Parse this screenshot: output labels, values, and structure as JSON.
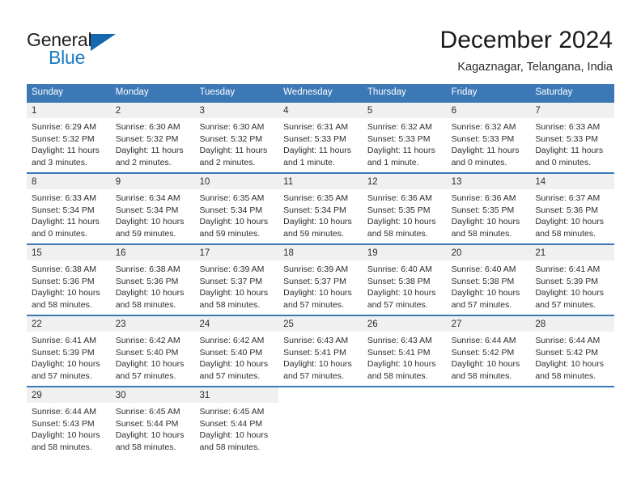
{
  "brand": {
    "name_top": "General",
    "name_bottom": "Blue",
    "color_dark": "#231f20",
    "color_blue": "#1a7bc4",
    "triangle_color": "#1368ae"
  },
  "header": {
    "title": "December 2024",
    "subtitle": "Kagaznagar, Telangana, India"
  },
  "theme": {
    "header_blue": "#3b78b5",
    "day_band_gray": "#f0f0f0",
    "text_color": "#2d2d2d"
  },
  "weekdays": [
    "Sunday",
    "Monday",
    "Tuesday",
    "Wednesday",
    "Thursday",
    "Friday",
    "Saturday"
  ],
  "weeks": [
    [
      {
        "day": "1",
        "sunrise": "Sunrise: 6:29 AM",
        "sunset": "Sunset: 5:32 PM",
        "daylight1": "Daylight: 11 hours",
        "daylight2": "and 3 minutes."
      },
      {
        "day": "2",
        "sunrise": "Sunrise: 6:30 AM",
        "sunset": "Sunset: 5:32 PM",
        "daylight1": "Daylight: 11 hours",
        "daylight2": "and 2 minutes."
      },
      {
        "day": "3",
        "sunrise": "Sunrise: 6:30 AM",
        "sunset": "Sunset: 5:32 PM",
        "daylight1": "Daylight: 11 hours",
        "daylight2": "and 2 minutes."
      },
      {
        "day": "4",
        "sunrise": "Sunrise: 6:31 AM",
        "sunset": "Sunset: 5:33 PM",
        "daylight1": "Daylight: 11 hours",
        "daylight2": "and 1 minute."
      },
      {
        "day": "5",
        "sunrise": "Sunrise: 6:32 AM",
        "sunset": "Sunset: 5:33 PM",
        "daylight1": "Daylight: 11 hours",
        "daylight2": "and 1 minute."
      },
      {
        "day": "6",
        "sunrise": "Sunrise: 6:32 AM",
        "sunset": "Sunset: 5:33 PM",
        "daylight1": "Daylight: 11 hours",
        "daylight2": "and 0 minutes."
      },
      {
        "day": "7",
        "sunrise": "Sunrise: 6:33 AM",
        "sunset": "Sunset: 5:33 PM",
        "daylight1": "Daylight: 11 hours",
        "daylight2": "and 0 minutes."
      }
    ],
    [
      {
        "day": "8",
        "sunrise": "Sunrise: 6:33 AM",
        "sunset": "Sunset: 5:34 PM",
        "daylight1": "Daylight: 11 hours",
        "daylight2": "and 0 minutes."
      },
      {
        "day": "9",
        "sunrise": "Sunrise: 6:34 AM",
        "sunset": "Sunset: 5:34 PM",
        "daylight1": "Daylight: 10 hours",
        "daylight2": "and 59 minutes."
      },
      {
        "day": "10",
        "sunrise": "Sunrise: 6:35 AM",
        "sunset": "Sunset: 5:34 PM",
        "daylight1": "Daylight: 10 hours",
        "daylight2": "and 59 minutes."
      },
      {
        "day": "11",
        "sunrise": "Sunrise: 6:35 AM",
        "sunset": "Sunset: 5:34 PM",
        "daylight1": "Daylight: 10 hours",
        "daylight2": "and 59 minutes."
      },
      {
        "day": "12",
        "sunrise": "Sunrise: 6:36 AM",
        "sunset": "Sunset: 5:35 PM",
        "daylight1": "Daylight: 10 hours",
        "daylight2": "and 58 minutes."
      },
      {
        "day": "13",
        "sunrise": "Sunrise: 6:36 AM",
        "sunset": "Sunset: 5:35 PM",
        "daylight1": "Daylight: 10 hours",
        "daylight2": "and 58 minutes."
      },
      {
        "day": "14",
        "sunrise": "Sunrise: 6:37 AM",
        "sunset": "Sunset: 5:36 PM",
        "daylight1": "Daylight: 10 hours",
        "daylight2": "and 58 minutes."
      }
    ],
    [
      {
        "day": "15",
        "sunrise": "Sunrise: 6:38 AM",
        "sunset": "Sunset: 5:36 PM",
        "daylight1": "Daylight: 10 hours",
        "daylight2": "and 58 minutes."
      },
      {
        "day": "16",
        "sunrise": "Sunrise: 6:38 AM",
        "sunset": "Sunset: 5:36 PM",
        "daylight1": "Daylight: 10 hours",
        "daylight2": "and 58 minutes."
      },
      {
        "day": "17",
        "sunrise": "Sunrise: 6:39 AM",
        "sunset": "Sunset: 5:37 PM",
        "daylight1": "Daylight: 10 hours",
        "daylight2": "and 58 minutes."
      },
      {
        "day": "18",
        "sunrise": "Sunrise: 6:39 AM",
        "sunset": "Sunset: 5:37 PM",
        "daylight1": "Daylight: 10 hours",
        "daylight2": "and 57 minutes."
      },
      {
        "day": "19",
        "sunrise": "Sunrise: 6:40 AM",
        "sunset": "Sunset: 5:38 PM",
        "daylight1": "Daylight: 10 hours",
        "daylight2": "and 57 minutes."
      },
      {
        "day": "20",
        "sunrise": "Sunrise: 6:40 AM",
        "sunset": "Sunset: 5:38 PM",
        "daylight1": "Daylight: 10 hours",
        "daylight2": "and 57 minutes."
      },
      {
        "day": "21",
        "sunrise": "Sunrise: 6:41 AM",
        "sunset": "Sunset: 5:39 PM",
        "daylight1": "Daylight: 10 hours",
        "daylight2": "and 57 minutes."
      }
    ],
    [
      {
        "day": "22",
        "sunrise": "Sunrise: 6:41 AM",
        "sunset": "Sunset: 5:39 PM",
        "daylight1": "Daylight: 10 hours",
        "daylight2": "and 57 minutes."
      },
      {
        "day": "23",
        "sunrise": "Sunrise: 6:42 AM",
        "sunset": "Sunset: 5:40 PM",
        "daylight1": "Daylight: 10 hours",
        "daylight2": "and 57 minutes."
      },
      {
        "day": "24",
        "sunrise": "Sunrise: 6:42 AM",
        "sunset": "Sunset: 5:40 PM",
        "daylight1": "Daylight: 10 hours",
        "daylight2": "and 57 minutes."
      },
      {
        "day": "25",
        "sunrise": "Sunrise: 6:43 AM",
        "sunset": "Sunset: 5:41 PM",
        "daylight1": "Daylight: 10 hours",
        "daylight2": "and 57 minutes."
      },
      {
        "day": "26",
        "sunrise": "Sunrise: 6:43 AM",
        "sunset": "Sunset: 5:41 PM",
        "daylight1": "Daylight: 10 hours",
        "daylight2": "and 58 minutes."
      },
      {
        "day": "27",
        "sunrise": "Sunrise: 6:44 AM",
        "sunset": "Sunset: 5:42 PM",
        "daylight1": "Daylight: 10 hours",
        "daylight2": "and 58 minutes."
      },
      {
        "day": "28",
        "sunrise": "Sunrise: 6:44 AM",
        "sunset": "Sunset: 5:42 PM",
        "daylight1": "Daylight: 10 hours",
        "daylight2": "and 58 minutes."
      }
    ],
    [
      {
        "day": "29",
        "sunrise": "Sunrise: 6:44 AM",
        "sunset": "Sunset: 5:43 PM",
        "daylight1": "Daylight: 10 hours",
        "daylight2": "and 58 minutes."
      },
      {
        "day": "30",
        "sunrise": "Sunrise: 6:45 AM",
        "sunset": "Sunset: 5:44 PM",
        "daylight1": "Daylight: 10 hours",
        "daylight2": "and 58 minutes."
      },
      {
        "day": "31",
        "sunrise": "Sunrise: 6:45 AM",
        "sunset": "Sunset: 5:44 PM",
        "daylight1": "Daylight: 10 hours",
        "daylight2": "and 58 minutes."
      },
      {
        "day": "",
        "sunrise": "",
        "sunset": "",
        "daylight1": "",
        "daylight2": ""
      },
      {
        "day": "",
        "sunrise": "",
        "sunset": "",
        "daylight1": "",
        "daylight2": ""
      },
      {
        "day": "",
        "sunrise": "",
        "sunset": "",
        "daylight1": "",
        "daylight2": ""
      },
      {
        "day": "",
        "sunrise": "",
        "sunset": "",
        "daylight1": "",
        "daylight2": ""
      }
    ]
  ]
}
